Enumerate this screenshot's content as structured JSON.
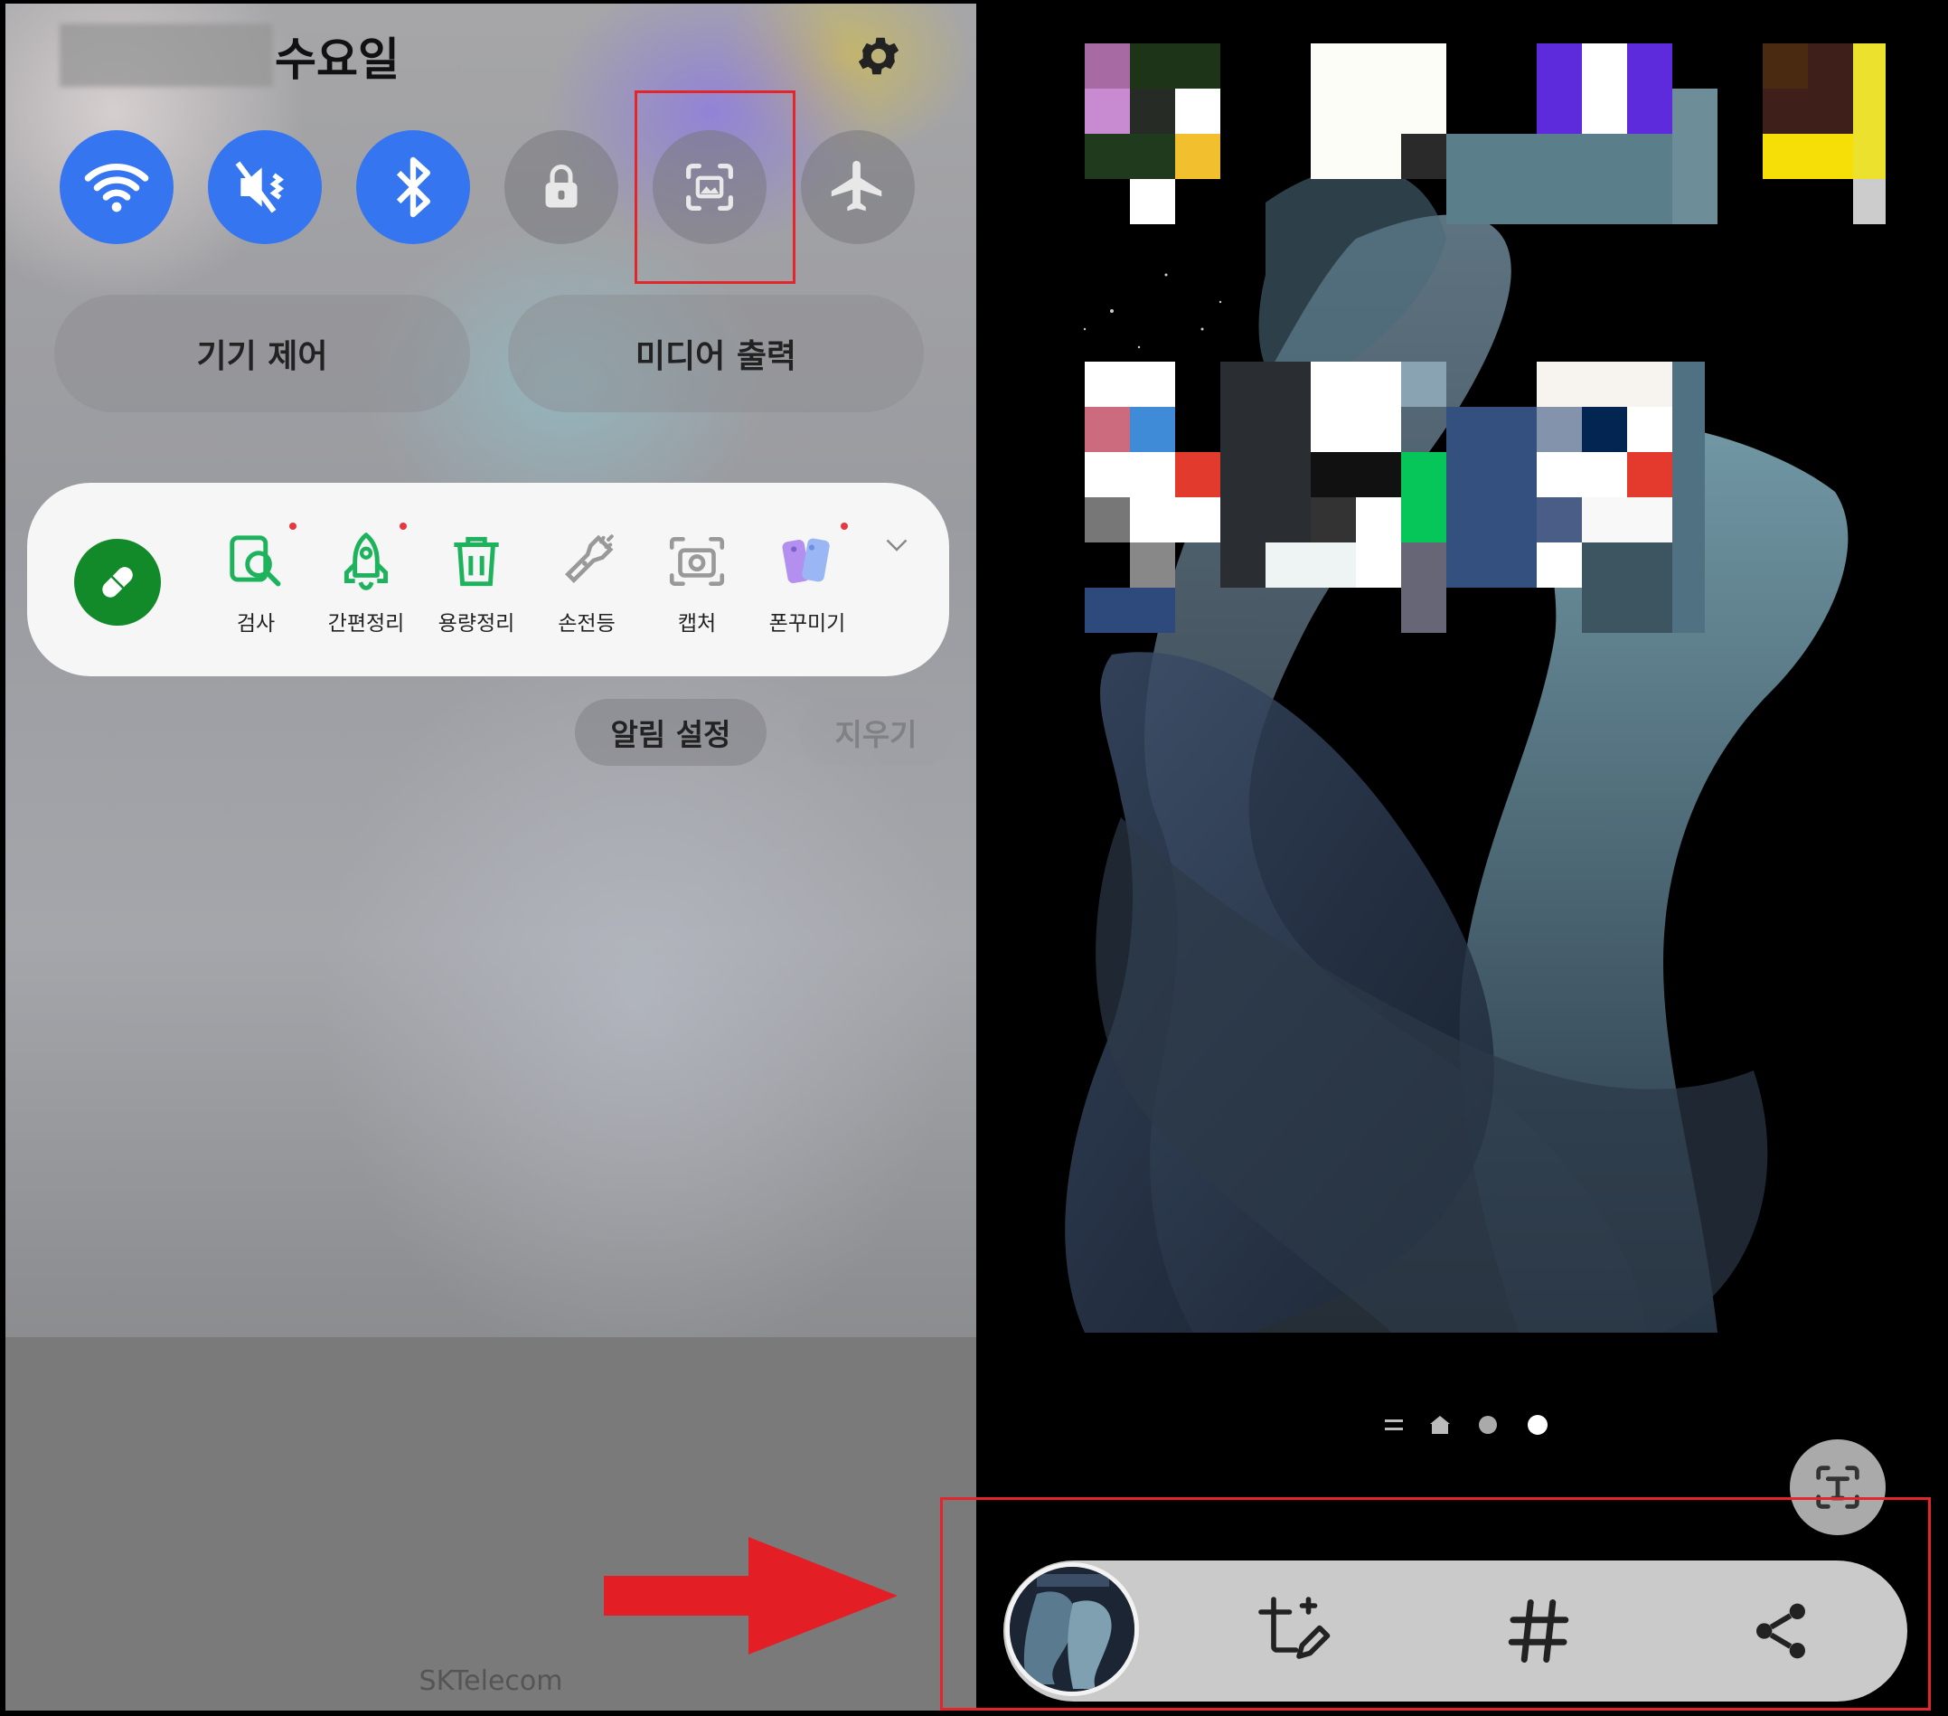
{
  "status": {
    "day": "수요일"
  },
  "quick_settings": [
    {
      "name": "wifi",
      "icon": "wifi-icon",
      "state": "on"
    },
    {
      "name": "sound",
      "icon": "mute-vibrate-icon",
      "state": "on"
    },
    {
      "name": "bluetooth",
      "icon": "bluetooth-icon",
      "state": "on"
    },
    {
      "name": "lock",
      "icon": "lock-icon",
      "state": "off"
    },
    {
      "name": "screenshot",
      "icon": "screen-capture-icon",
      "state": "off"
    },
    {
      "name": "airplane",
      "icon": "airplane-icon",
      "state": "off"
    }
  ],
  "pills": {
    "device_control": "기기 제어",
    "media_output": "미디어 출력"
  },
  "tools": [
    {
      "label": "검사",
      "icon": "search-doc-icon",
      "badge": true
    },
    {
      "label": "간편정리",
      "icon": "rocket-icon",
      "badge": true
    },
    {
      "label": "용량정리",
      "icon": "trash-icon",
      "badge": false
    },
    {
      "label": "손전등",
      "icon": "flashlight-icon",
      "badge": false
    },
    {
      "label": "캡처",
      "icon": "camera-icon",
      "badge": false
    },
    {
      "label": "폰꾸미기",
      "icon": "phone-cases-icon",
      "badge": true
    }
  ],
  "notifications": {
    "settings": "알림 설정",
    "clear": "지우기"
  },
  "carrier": "SKTelecom",
  "screenshot_toolbar": {
    "items": [
      "thumbnail",
      "crop-edit-icon",
      "hashtag-icon",
      "share-icon"
    ]
  },
  "colors": {
    "accent_blue": "#3576f0",
    "tool_green": "#1db35c",
    "highlight_red": "#e3262c"
  }
}
